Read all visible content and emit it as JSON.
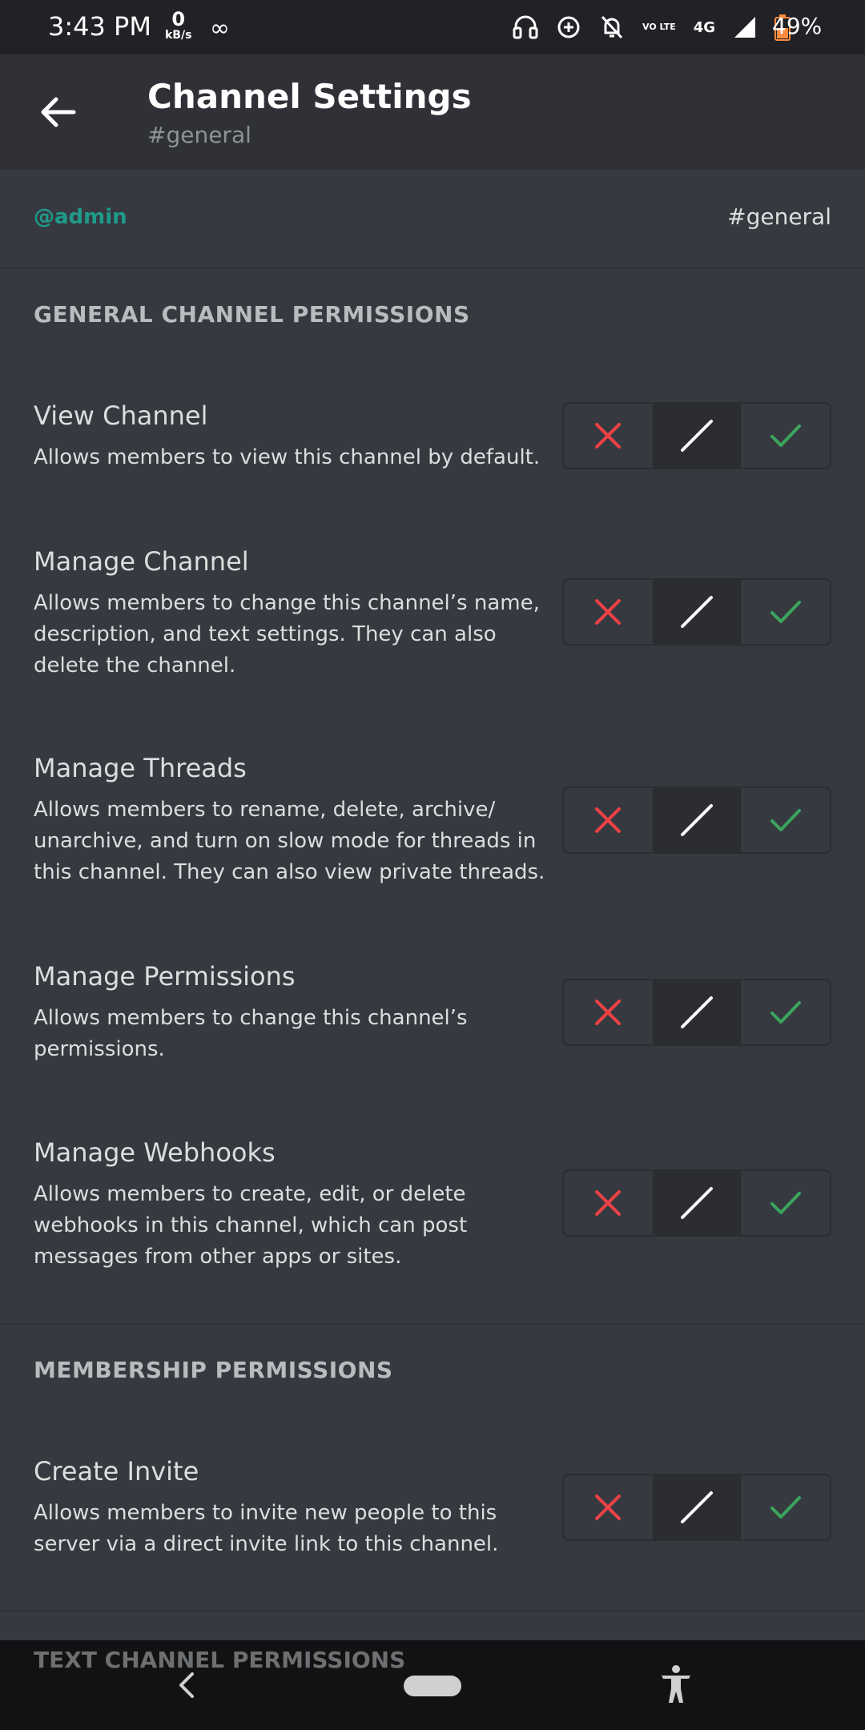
{
  "status_bar": {
    "time": "3:43 PM",
    "net_speed_value": "0",
    "net_speed_unit": "kB/s",
    "network": "4G",
    "volte": "VO LTE",
    "battery": "49%"
  },
  "header": {
    "title": "Channel Settings",
    "subtitle": "#general"
  },
  "target": {
    "role": "@admin",
    "channel": "#general"
  },
  "sections": {
    "general_title": "GENERAL CHANNEL PERMISSIONS",
    "membership_title": "MEMBERSHIP PERMISSIONS",
    "text_title": "TEXT CHANNEL PERMISSIONS"
  },
  "permissions": [
    {
      "name": "View Channel",
      "desc": "Allows members to view this channel by default.",
      "state": "neutral"
    },
    {
      "name": "Manage Channel",
      "desc": "Allows members to change this channel’s name, description, and text settings. They can also delete the channel.",
      "state": "neutral"
    },
    {
      "name": "Manage Threads",
      "desc": "Allows members to rename, delete, archive/ unarchive, and turn on slow mode for threads in this channel. They can also view private threads.",
      "state": "neutral"
    },
    {
      "name": "Manage Permissions",
      "desc": "Allows members to change this channel’s permissions.",
      "state": "neutral"
    },
    {
      "name": "Manage Webhooks",
      "desc": "Allows members to create, edit, or delete webhooks in this channel, which can post messages from other apps or sites.",
      "state": "neutral"
    },
    {
      "name": "Create Invite",
      "desc": "Allows members to invite new people to this server via a direct invite link to this channel.",
      "state": "neutral"
    }
  ],
  "colors": {
    "deny": "#ed4245",
    "allow": "#3ba55d",
    "role": "#1e9b8a"
  },
  "icons": {
    "back": "arrow-left-icon",
    "deny": "x-icon",
    "neutral": "slash-icon",
    "allow": "check-icon"
  }
}
